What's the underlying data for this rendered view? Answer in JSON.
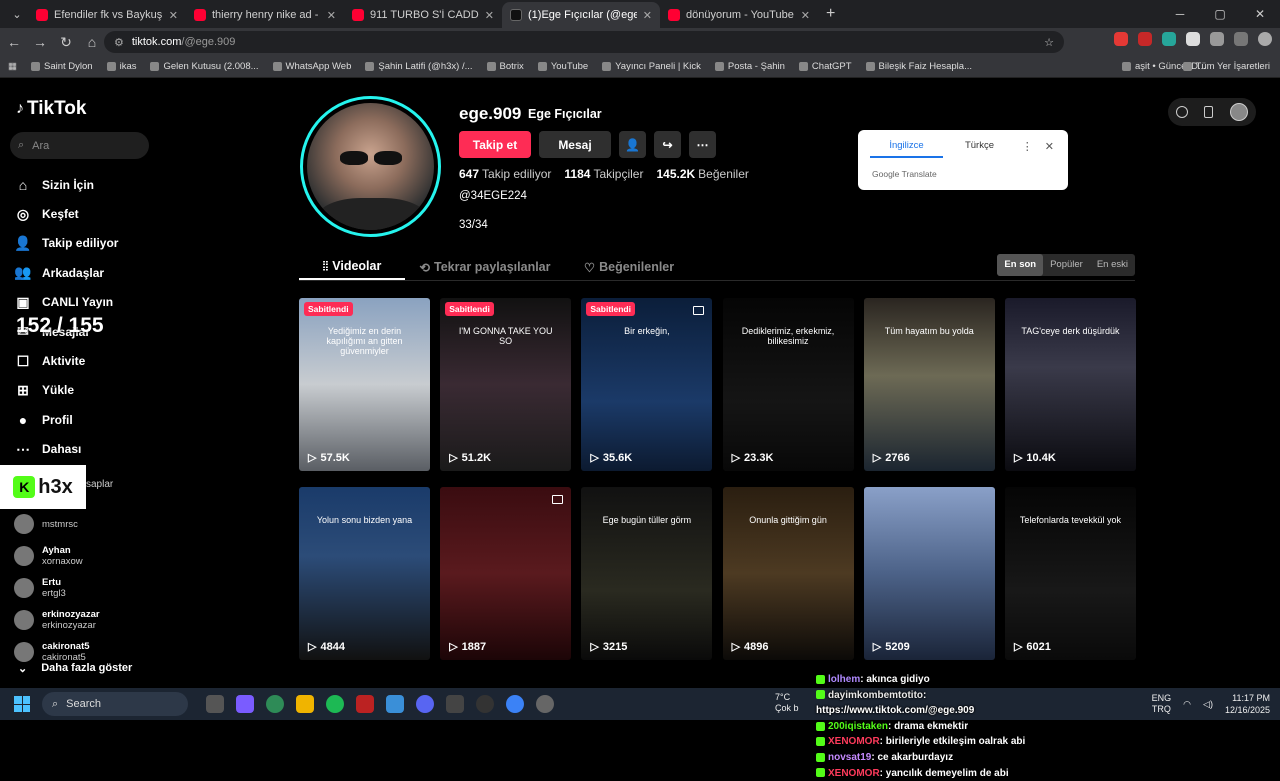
{
  "browser": {
    "tabs": [
      {
        "title": "Efendiler fk vs Baykuş F.C - YouT",
        "fav": "yt",
        "active": false
      },
      {
        "title": "thierry henry nike ad - YouTube",
        "fav": "yt",
        "active": false
      },
      {
        "title": "911 TURBO S'İ CADDE'YE İNDİR",
        "fav": "yt",
        "active": false
      },
      {
        "title": "(1)Ege Fıçıcılar (@ege.909) | Tik",
        "fav": "tt",
        "active": true
      },
      {
        "title": "dönüyorum - YouTube",
        "fav": "yt",
        "active": false
      }
    ],
    "url_site": "tiktok.com",
    "url_path": "/@ege.909",
    "bookmarks": [
      "Saint Dylon",
      "ikas",
      "Gelen Kutusu (2.008...",
      "WhatsApp Web",
      "Şahin Latifi (@h3x) /...",
      "Botrix",
      "YouTube",
      "Yayıncı Paneli | Kick",
      "Posta - Şahin",
      "ChatGPT",
      "Bileşik Faiz Hesapla...",
      "aşit • Güncel D...",
      "Tüm Yer İşaretleri"
    ]
  },
  "translate": {
    "lang_from": "İngilizce",
    "lang_to": "Türkçe",
    "brand": "Google Translate"
  },
  "sidebar": {
    "logo": "TikTok",
    "search_placeholder": "Ara",
    "items": [
      {
        "label": "Sizin İçin",
        "icon": "home-icon",
        "glyph": "⌂"
      },
      {
        "label": "Keşfet",
        "icon": "compass-icon",
        "glyph": "◎"
      },
      {
        "label": "Takip ediliyor",
        "icon": "following-icon",
        "glyph": "👤"
      },
      {
        "label": "Arkadaşlar",
        "icon": "friends-icon",
        "glyph": "👥"
      },
      {
        "label": "CANLI Yayın",
        "icon": "live-icon",
        "glyph": "▣"
      },
      {
        "label": "Mesajlar",
        "icon": "messages-icon",
        "glyph": "✉"
      },
      {
        "label": "Aktivite",
        "icon": "activity-icon",
        "glyph": "☐"
      },
      {
        "label": "Yükle",
        "icon": "upload-icon",
        "glyph": "⊞"
      },
      {
        "label": "Profil",
        "icon": "profile-icon",
        "glyph": "●"
      },
      {
        "label": "Dahası",
        "icon": "more-icon",
        "glyph": "⋯"
      }
    ],
    "following_heading": "saplar",
    "following": [
      {
        "name": "",
        "handle": "mstmrsc"
      },
      {
        "name": "Ayhan",
        "handle": "xornaxow"
      },
      {
        "name": "Ertu",
        "handle": "ertgl3"
      },
      {
        "name": "erkinozyazar",
        "handle": "erkinozyazar"
      },
      {
        "name": "cakironat5",
        "handle": "cakironat5"
      }
    ],
    "show_more": "Daha fazla göster"
  },
  "overlay": {
    "counter": "152 / 155",
    "brand": "h3x"
  },
  "profile": {
    "username": "ege.909",
    "display_name": "Ege Fıçıcılar",
    "follow_label": "Takip et",
    "message_label": "Mesaj",
    "following_count": "647",
    "following_label": "Takip ediliyor",
    "followers_count": "1184",
    "followers_label": "Takipçiler",
    "likes_count": "145.2K",
    "likes_label": "Beğeniler",
    "bio": "@34EGE224",
    "bio2": "33/34"
  },
  "content_tabs": [
    "Videolar",
    "Tekrar paylaşılanlar",
    "Beğenilenler"
  ],
  "sort": [
    "En son",
    "Popüler",
    "En eski"
  ],
  "videos": [
    {
      "views": "57.5K",
      "pinned": "Sabitlendi",
      "caption": "Yediğimiz en derin kapılığımı an gitten güvenmiyler",
      "bg": "linear-gradient(#8aa2c0,#c8ccd0 50%,#5a5e64)"
    },
    {
      "views": "51.2K",
      "pinned": "Sabitlendi",
      "caption": "I'M GONNA TAKE YOU SO",
      "bg": "linear-gradient(#111,#3a2a33 50%,#1a1a1a)"
    },
    {
      "views": "35.6K",
      "pinned": "Sabitlendi",
      "caption": "Bir erkeğin,",
      "bg": "linear-gradient(#0b1e3a,#1b3a68 60%,#0c1a30)"
    },
    {
      "views": "23.3K",
      "pinned": "",
      "caption": "Dediklerimiz, erkekmiz, bilikesimiz",
      "bg": "linear-gradient(#050505,#151515 60%,#080808)"
    },
    {
      "views": "2766",
      "pinned": "",
      "caption": "Tüm hayatım bu yolda",
      "bg": "linear-gradient(#2a2520,#6d6a55 45%,#1b2530)"
    },
    {
      "views": "10.4K",
      "pinned": "",
      "caption": "TAG'ceye derk düşürdük",
      "bg": "linear-gradient(#1a1a2a,#3a3a4a 40%,#0b0b10)"
    },
    {
      "views": "4844",
      "pinned": "",
      "caption": "Yolun sonu bizden yana",
      "bg": "linear-gradient(#1a3b6a,#2c4c78 40%,#111)"
    },
    {
      "views": "1887",
      "pinned": "",
      "caption": "",
      "bg": "linear-gradient(#3a0c10,#5a1a1e 50%,#1c0507)"
    },
    {
      "views": "3215",
      "pinned": "",
      "caption": "Ege bugün tüller görm",
      "bg": "linear-gradient(#111,#2a2a20 60%,#0a0a0a)"
    },
    {
      "views": "4896",
      "pinned": "",
      "caption": "Onunla gittiğim gün",
      "bg": "linear-gradient(#2a1e10,#4d3a22 50%,#0c0a08)"
    },
    {
      "views": "5209",
      "pinned": "",
      "caption": "",
      "bg": "linear-gradient(#8aa0c8,#4c6288 50%,#1a2438)"
    },
    {
      "views": "6021",
      "pinned": "",
      "caption": "Telefonlarda tevekkül yok",
      "bg": "linear-gradient(#050505,#181818 60%,#0a0a0a)"
    }
  ],
  "chat": [
    {
      "user": "lolhem",
      "msg": ": akınca gidiyo",
      "color": "u1"
    },
    {
      "user": "dayimkombemtotito",
      "msg": ":",
      "color": "u2"
    },
    {
      "user": "",
      "msg": "https://www.tiktok.com/@ege.909",
      "color": "u2"
    },
    {
      "user": "200iqistaken",
      "msg": ": drama ekmektir",
      "color": "u3"
    },
    {
      "user": "XENOMOR",
      "msg": ": birileriyle etkileşim oalrak abi",
      "color": "u4"
    },
    {
      "user": "novsat19",
      "msg": ": ce akarburdayız",
      "color": "u5"
    },
    {
      "user": "XENOMOR",
      "msg": ": yancılık demeyelim de abi",
      "color": "u4"
    }
  ],
  "taskbar": {
    "search": "Search",
    "temp": "7°C",
    "weather": "Çok b",
    "lang1": "ENG",
    "lang2": "TRQ",
    "time": "11:17 PM",
    "date": "12/16/2025"
  }
}
